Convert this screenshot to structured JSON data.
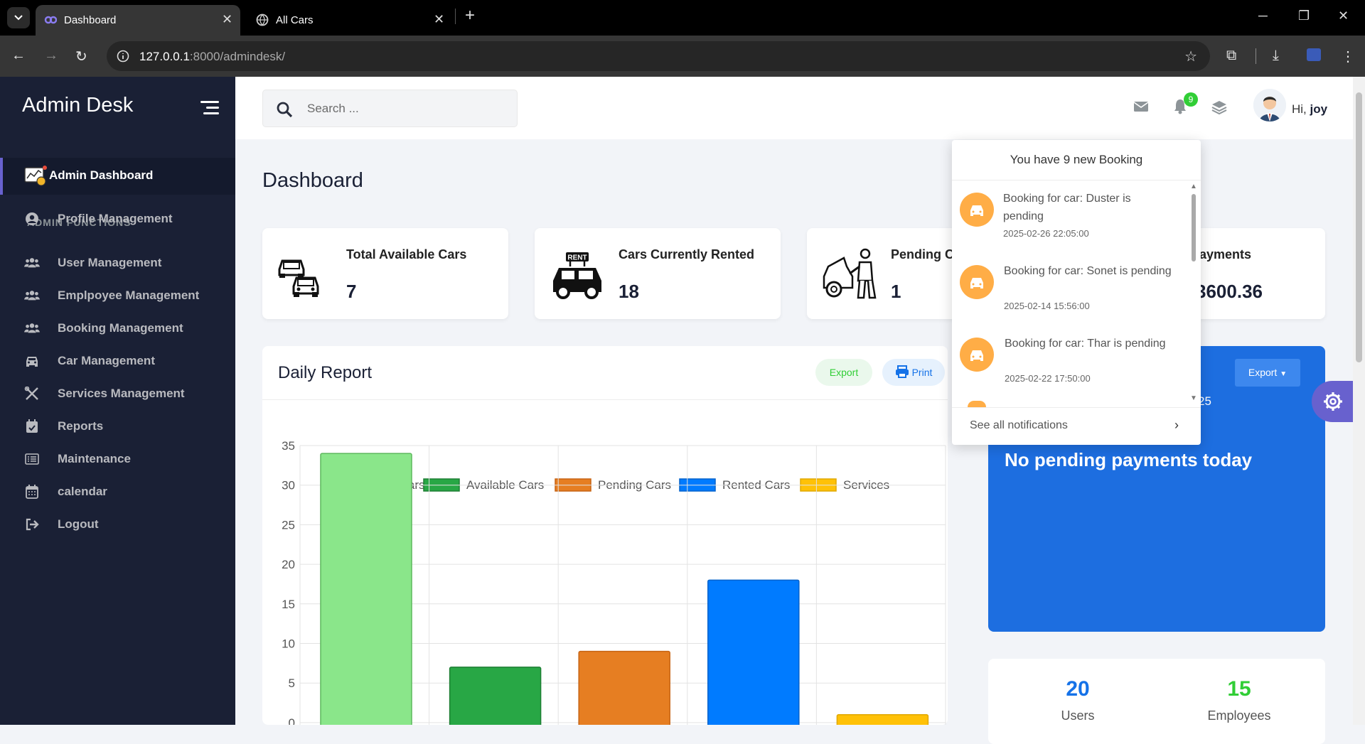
{
  "browser": {
    "tabs": [
      {
        "label": "Dashboard",
        "active": true
      },
      {
        "label": "All Cars",
        "active": false
      }
    ],
    "url_host": "127.0.0.1",
    "url_rest": ":8000/admindesk/"
  },
  "sidebar": {
    "brand": "Admin Desk",
    "active_item": "Admin Dashboard",
    "section_label": "ADMIN FUNCTIONS",
    "items": [
      {
        "label": "Profile Management",
        "icon": "user-circle-icon"
      },
      {
        "label": "User Management",
        "icon": "users-icon"
      },
      {
        "label": "Emplpoyee Management",
        "icon": "users-icon"
      },
      {
        "label": "Booking Management",
        "icon": "users-icon"
      },
      {
        "label": "Car Management",
        "icon": "car-icon"
      },
      {
        "label": "Services Management",
        "icon": "tools-icon"
      },
      {
        "label": "Reports",
        "icon": "calendar-check-icon"
      },
      {
        "label": "Maintenance",
        "icon": "list-icon"
      },
      {
        "label": "calendar",
        "icon": "calendar-icon"
      },
      {
        "label": "Logout",
        "icon": "logout-icon"
      }
    ]
  },
  "topbar": {
    "search_placeholder": "Search ...",
    "notification_count": "9",
    "greeting": "Hi,",
    "username": "joy"
  },
  "main": {
    "title": "Dashboard",
    "cards": [
      {
        "title": "Total Available Cars",
        "value": "7"
      },
      {
        "title": "Cars Currently Rented",
        "value": "18"
      },
      {
        "title": "Pending C",
        "value": "1"
      },
      {
        "title": "ng Payments",
        "value": "3600.36"
      }
    ],
    "report": {
      "title": "Daily Report",
      "export_label": "Export",
      "print_label": "Print"
    },
    "payments": {
      "export_label": "Export",
      "date_fragment": "25",
      "message": "No pending payments today"
    },
    "stats": [
      {
        "value": "20",
        "label": "Users",
        "color": "#1572e8"
      },
      {
        "value": "15",
        "label": "Employees",
        "color": "#31ce36"
      }
    ]
  },
  "notifications": {
    "header": "You have 9 new Booking",
    "items": [
      {
        "text": "Booking for car: Duster is pending",
        "time": "2025-02-26 22:05:00"
      },
      {
        "text": "Booking for car: Sonet is pending",
        "time": "2025-02-14 15:56:00"
      },
      {
        "text": "Booking for car: Thar is pending",
        "time": "2025-02-22 17:50:00"
      }
    ],
    "footer": "See all notifications"
  },
  "chart_data": {
    "type": "bar",
    "categories": [
      "Total Cars",
      "Available Cars",
      "Pending Cars",
      "Rented Cars",
      "Services"
    ],
    "values": [
      34,
      7,
      9,
      18,
      1
    ],
    "legend": [
      "Total Cars",
      "Available Cars",
      "Pending Cars",
      "Rented Cars",
      "Services"
    ],
    "colors": [
      "#8ae68a",
      "#28a745",
      "#e67e22",
      "#007bff",
      "#ffc107"
    ],
    "borders": [
      "#5cb85c",
      "#1e7e34",
      "#c76414",
      "#0062cc",
      "#e0a800"
    ],
    "ylim": [
      0,
      35
    ],
    "yticks": [
      0,
      5,
      10,
      15,
      20,
      25,
      30,
      35
    ],
    "grid": true,
    "legend_position": "top"
  }
}
